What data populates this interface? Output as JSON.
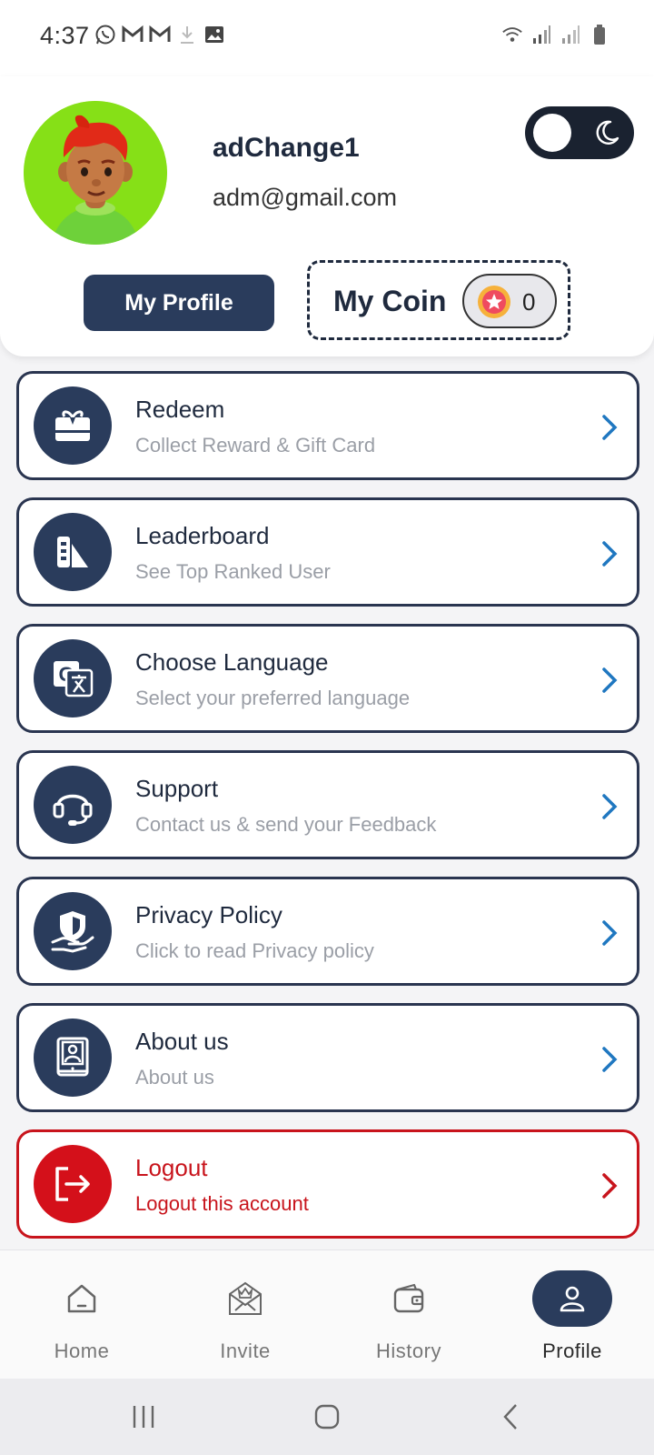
{
  "status_bar": {
    "time": "4:37",
    "left_icons": [
      "whatsapp-icon",
      "gmail-icon",
      "gmail-icon",
      "download-icon",
      "gallery-icon"
    ],
    "right_icons": [
      "wifi-icon",
      "signal-icon",
      "signal-icon",
      "battery-icon"
    ]
  },
  "profile": {
    "name": "adChange1",
    "email": "adm@gmail.com",
    "theme": "light",
    "my_profile_label": "My Profile",
    "coin_label": "My Coin",
    "coin_value": "0"
  },
  "menu": [
    {
      "id": "redeem",
      "title": "Redeem",
      "subtitle": "Collect Reward & Gift Card",
      "icon": "gift-card-icon"
    },
    {
      "id": "leaderboard",
      "title": "Leaderboard",
      "subtitle": "See Top Ranked User",
      "icon": "leaderboard-icon"
    },
    {
      "id": "language",
      "title": "Choose Language",
      "subtitle": "Select your preferred language",
      "icon": "translate-icon"
    },
    {
      "id": "support",
      "title": "Support",
      "subtitle": "Contact us & send your Feedback",
      "icon": "headset-icon"
    },
    {
      "id": "privacy",
      "title": "Privacy Policy",
      "subtitle": "Click to read Privacy policy",
      "icon": "shield-hand-icon"
    },
    {
      "id": "about",
      "title": "About us",
      "subtitle": "About us",
      "icon": "contact-book-icon"
    },
    {
      "id": "logout",
      "title": "Logout",
      "subtitle": "Logout this account",
      "icon": "logout-icon"
    }
  ],
  "bottom_nav": [
    {
      "label": "Home",
      "icon": "home-icon",
      "active": false
    },
    {
      "label": "Invite",
      "icon": "invite-icon",
      "active": false
    },
    {
      "label": "History",
      "icon": "wallet-icon",
      "active": false
    },
    {
      "label": "Profile",
      "icon": "user-icon",
      "active": true
    }
  ],
  "colors": {
    "primary": "#2a3c5c",
    "danger": "#c8141c",
    "avatar_bg": "#86e017",
    "chevron": "#1f77c0"
  }
}
